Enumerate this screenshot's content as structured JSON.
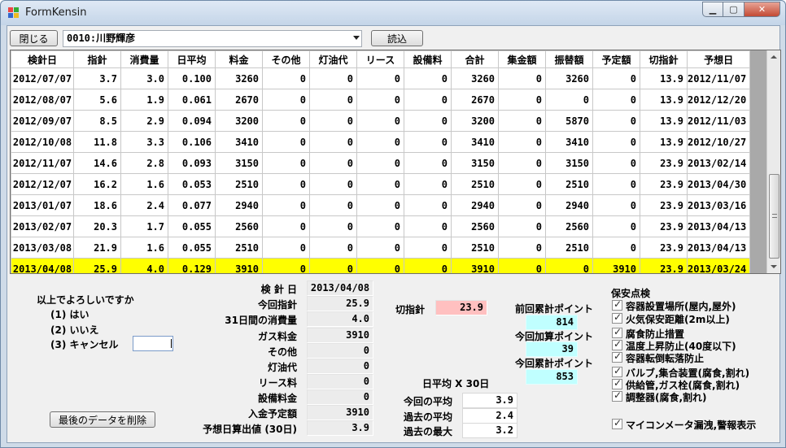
{
  "window": {
    "title": "FormKensin"
  },
  "toolbar": {
    "close_label": "閉じる",
    "customer_value": "0010:川野輝彦",
    "load_label": "読込"
  },
  "grid": {
    "columns": [
      "検針日",
      "指針",
      "消費量",
      "日平均",
      "料金",
      "その他",
      "灯油代",
      "リース",
      "設備料",
      "合計",
      "集金額",
      "振替額",
      "予定額",
      "切指針",
      "予想日"
    ],
    "rows": [
      [
        "2012/07/07",
        "3.7",
        "3.0",
        "0.100",
        "3260",
        "0",
        "0",
        "0",
        "0",
        "3260",
        "0",
        "3260",
        "0",
        "13.9",
        "2012/11/07"
      ],
      [
        "2012/08/07",
        "5.6",
        "1.9",
        "0.061",
        "2670",
        "0",
        "0",
        "0",
        "0",
        "2670",
        "0",
        "0",
        "0",
        "13.9",
        "2012/12/20"
      ],
      [
        "2012/09/07",
        "8.5",
        "2.9",
        "0.094",
        "3200",
        "0",
        "0",
        "0",
        "0",
        "3200",
        "0",
        "5870",
        "0",
        "13.9",
        "2012/11/03"
      ],
      [
        "2012/10/08",
        "11.8",
        "3.3",
        "0.106",
        "3410",
        "0",
        "0",
        "0",
        "0",
        "3410",
        "0",
        "3410",
        "0",
        "13.9",
        "2012/10/27"
      ],
      [
        "2012/11/07",
        "14.6",
        "2.8",
        "0.093",
        "3150",
        "0",
        "0",
        "0",
        "0",
        "3150",
        "0",
        "3150",
        "0",
        "23.9",
        "2013/02/14"
      ],
      [
        "2012/12/07",
        "16.2",
        "1.6",
        "0.053",
        "2510",
        "0",
        "0",
        "0",
        "0",
        "2510",
        "0",
        "2510",
        "0",
        "23.9",
        "2013/04/30"
      ],
      [
        "2013/01/07",
        "18.6",
        "2.4",
        "0.077",
        "2940",
        "0",
        "0",
        "0",
        "0",
        "2940",
        "0",
        "2940",
        "0",
        "23.9",
        "2013/03/16"
      ],
      [
        "2013/02/07",
        "20.3",
        "1.7",
        "0.055",
        "2560",
        "0",
        "0",
        "0",
        "0",
        "2560",
        "0",
        "2560",
        "0",
        "23.9",
        "2013/04/13"
      ],
      [
        "2013/03/08",
        "21.9",
        "1.6",
        "0.055",
        "2510",
        "0",
        "0",
        "0",
        "0",
        "2510",
        "0",
        "2510",
        "0",
        "23.9",
        "2013/04/13"
      ],
      [
        "2013/04/08",
        "25.9",
        "4.0",
        "0.129",
        "3910",
        "0",
        "0",
        "0",
        "0",
        "3910",
        "0",
        "0",
        "3910",
        "23.9",
        "2013/03/24"
      ]
    ],
    "selected_row": 9
  },
  "confirm": {
    "question": "以上でよろしいですか",
    "options": [
      "(1) はい",
      "(2) いいえ",
      "(3) キャンセル"
    ],
    "input_value": ""
  },
  "delete_button": "最後のデータを削除",
  "summary": [
    {
      "label": "検 針 日",
      "value": "2013/04/08"
    },
    {
      "label": "今回指針",
      "value": "25.9"
    },
    {
      "label": "31日間の消費量",
      "value": "4.0"
    },
    {
      "label": "ガス料金",
      "value": "3910"
    },
    {
      "label": "その他",
      "value": "0"
    },
    {
      "label": "灯油代",
      "value": "0"
    },
    {
      "label": "リース料",
      "value": "0"
    },
    {
      "label": "設備料金",
      "value": "0"
    },
    {
      "label": "入金予定額",
      "value": "3910"
    },
    {
      "label": "予想日算出値 (30日)",
      "value": "3.9"
    }
  ],
  "cut": {
    "label": "切指針",
    "value": "23.9"
  },
  "daily_avg": {
    "title": "日平均 X 30日",
    "items": [
      {
        "label": "今回の平均",
        "value": "3.9"
      },
      {
        "label": "過去の平均",
        "value": "2.4"
      },
      {
        "label": "過去の最大",
        "value": "3.2"
      }
    ]
  },
  "points": [
    {
      "label": "前回累計ポイント",
      "value": "814"
    },
    {
      "label": "今回加算ポイント",
      "value": "39"
    },
    {
      "label": "今回累計ポイント",
      "value": "853"
    }
  ],
  "safety": {
    "title": "保安点検",
    "items": [
      "容器設置場所(屋内,屋外)",
      "火気保安距離(2m以上)",
      "腐食防止措置",
      "温度上昇防止(40度以下)",
      "容器転倒転落防止",
      "バルブ,集合装置(腐食,割れ)",
      "供給管,ガス栓(腐食,割れ)",
      "調整器(腐食,割れ)"
    ],
    "meter_label": "マイコンメータ漏洩,警報表示"
  },
  "colors": {
    "selected_row": "#ffff00",
    "cut_value_bg": "#ffc0c0",
    "point_value_bg": "#c0ffff"
  }
}
